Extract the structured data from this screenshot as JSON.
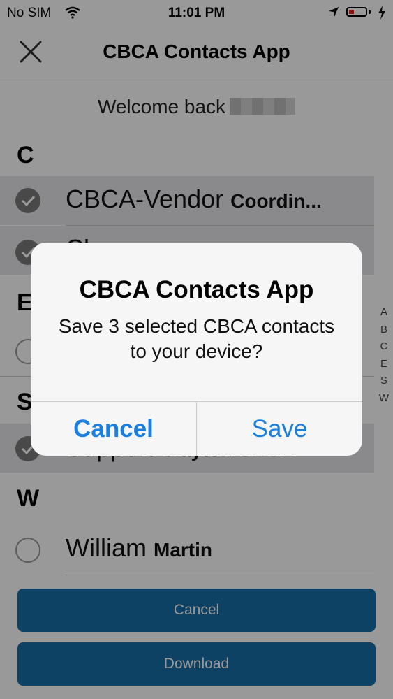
{
  "status_bar": {
    "carrier": "No SIM",
    "time": "11:01 PM",
    "icons": [
      "wifi-icon",
      "location-arrow-icon",
      "battery-low-icon",
      "charging-bolt-icon"
    ],
    "battery_color": "#e31818"
  },
  "nav": {
    "title": "CBCA Contacts App",
    "close_icon": "close-x-icon"
  },
  "welcome": {
    "text": "Welcome back"
  },
  "sections": [
    {
      "letter": "C",
      "contacts": [
        {
          "first": "CBCA-Vendor",
          "last": "Coordin...",
          "selected": true
        },
        {
          "first": "Cl",
          "last": "",
          "selected": true
        }
      ]
    },
    {
      "letter": "E",
      "contacts": [
        {
          "first": "",
          "last": "",
          "selected": false
        }
      ]
    },
    {
      "letter": "S",
      "contacts": [
        {
          "first": "Support",
          "last": "Clayton CBCA",
          "selected": true
        }
      ]
    },
    {
      "letter": "W",
      "contacts": [
        {
          "first": "William",
          "last": "Martin",
          "selected": false
        }
      ]
    }
  ],
  "index_letters": [
    "A",
    "B",
    "C",
    "E",
    "S",
    "W"
  ],
  "buttons": {
    "cancel": "Cancel",
    "download": "Download"
  },
  "colors": {
    "primary_button": "#176ea8",
    "alert_action": "#1b7fe0",
    "selected_row": "#e6e6ea"
  },
  "alert": {
    "title": "CBCA Contacts App",
    "message": "Save 3 selected CBCA contacts to your device?",
    "cancel": "Cancel",
    "save": "Save"
  }
}
